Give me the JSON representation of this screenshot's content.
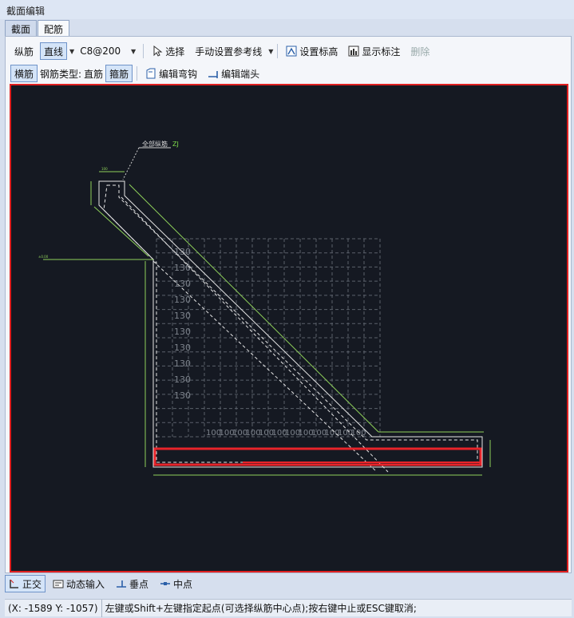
{
  "window": {
    "title": "截面编辑"
  },
  "tabs": [
    {
      "label": "截面"
    },
    {
      "label": "配筋"
    }
  ],
  "toolbar1": {
    "longitudinal": "纵筋",
    "line": "直线",
    "spec": "C8@200",
    "select": "选择",
    "manual_ref": "手动设置参考线",
    "set_elevation": "设置标高",
    "show_annotation": "显示标注",
    "delete": "删除"
  },
  "toolbar2": {
    "transverse": "横筋",
    "rebar_type_label": "钢筋类型:",
    "rebar_type_value": "直筋",
    "stirrup": "箍筋",
    "edit_hook": "编辑弯钩",
    "edit_end": "编辑端头"
  },
  "drawing": {
    "label_all": "全部纵筋",
    "label_zj": "ZJ",
    "grid_row_labels": [
      "130",
      "130",
      "130",
      "130",
      "130",
      "130",
      "130",
      "130",
      "130",
      "130"
    ],
    "grid_col_labels": [
      "100",
      "100",
      "100",
      "100",
      "100",
      "100",
      "100",
      "100",
      "100",
      "100",
      "100",
      "100"
    ],
    "colors": {
      "bg": "#151922",
      "dim": "#8fd15a",
      "rebar": "#e8242a",
      "line": "#e6e6e6",
      "grid": "#6a6f78"
    }
  },
  "bottom": {
    "ortho": "正交",
    "dynamic_input": "动态输入",
    "perpendicular": "垂点",
    "midpoint": "中点"
  },
  "status": {
    "coords": "(X: -1589 Y: -1057)",
    "hint": "左键或Shift+左键指定起点(可选择纵筋中心点);按右键中止或ESC键取消;"
  }
}
